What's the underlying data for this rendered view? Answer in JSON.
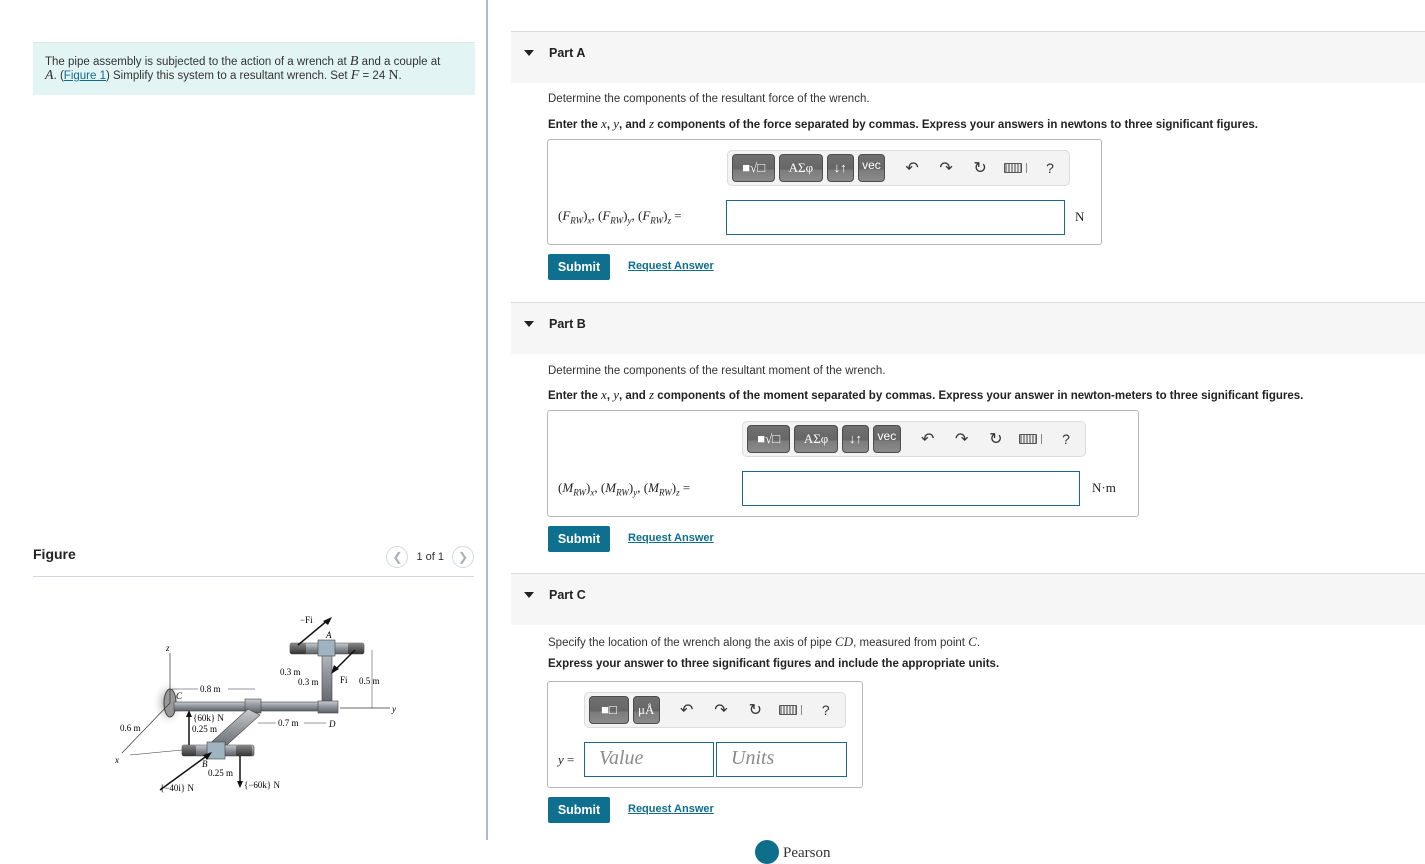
{
  "problem": {
    "text_1": "The pipe assembly is subjected to the action of a wrench at ",
    "var_B": "B",
    "text_2": " and a couple at ",
    "var_A": "A",
    "text_3": ". (",
    "figure_link": "Figure 1",
    "text_4": ") Simplify this system to a resultant wrench. Set ",
    "var_F": "F",
    "text_5": " = 24 ",
    "unit_N": "N",
    "text_6": "."
  },
  "figure": {
    "title": "Figure",
    "pager_text": "1 of 1",
    "prev_icon": "chevron-left",
    "next_icon": "chevron-right",
    "labels": {
      "neg_Fi": "−Fi",
      "A": "A",
      "z": "z",
      "d03a": "0.3 m",
      "d03b": "0.3 m",
      "Fi": "Fi",
      "d05": "0.5 m",
      "d08": "0.8 m",
      "C": "C",
      "y": "y",
      "f60k": "{60k} N",
      "d06": "0.6 m",
      "d025a": "0.25 m",
      "d07": "0.7 m",
      "D": "D",
      "x": "x",
      "B": "B",
      "d025b": "0.25 m",
      "fm40i": "{−40i} N",
      "fm60k": "{−60k} N"
    }
  },
  "parts": [
    {
      "label": "Part A",
      "description": "Determine the components of the resultant force of the wrench.",
      "instruction_pre": "Enter the ",
      "instruction_vars": [
        "x",
        "y",
        "z"
      ],
      "instruction_post": " components of the force separated by commas. Express your answers in newtons to three significant figures.",
      "toolbar": {
        "templates": "■√□",
        "greek": "ΑΣφ",
        "arrows": "↓↑",
        "vec": "vec",
        "undo": "↶",
        "redo": "↷",
        "reset": "↻",
        "help": "?"
      },
      "answer_label": {
        "sym": "F",
        "sub": "RW",
        "comps": [
          "x",
          "y",
          "z"
        ]
      },
      "input_value": "",
      "unit": "N",
      "submit": "Submit",
      "request": "Request Answer"
    },
    {
      "label": "Part B",
      "description": "Determine the components of the resultant moment of the wrench.",
      "instruction_pre": "Enter the ",
      "instruction_vars": [
        "x",
        "y",
        "z"
      ],
      "instruction_post": " components of the moment separated by commas. Express your answer in newton-meters to three significant figures.",
      "toolbar": {
        "templates": "■√□",
        "greek": "ΑΣφ",
        "arrows": "↓↑",
        "vec": "vec",
        "undo": "↶",
        "redo": "↷",
        "reset": "↻",
        "help": "?"
      },
      "answer_label": {
        "sym": "M",
        "sub": "RW",
        "comps": [
          "x",
          "y",
          "z"
        ]
      },
      "input_value": "",
      "unit": "N·m",
      "submit": "Submit",
      "request": "Request Answer"
    },
    {
      "label": "Part C",
      "description_pre": "Specify the location of the wrench along the axis of pipe ",
      "description_var1": "CD",
      "description_mid": ", measured from point ",
      "description_var2": "C",
      "description_post": ".",
      "instruction": "Express your answer to three significant figures and include the appropriate units.",
      "toolbar": {
        "templates": "■□",
        "units": "μÅ",
        "undo": "↶",
        "redo": "↷",
        "reset": "↻",
        "help": "?"
      },
      "answer_var": "y",
      "value_placeholder": "Value",
      "units_placeholder": "Units",
      "submit": "Submit",
      "request": "Request Answer"
    }
  ],
  "footer": {
    "brand": "Pearson"
  }
}
